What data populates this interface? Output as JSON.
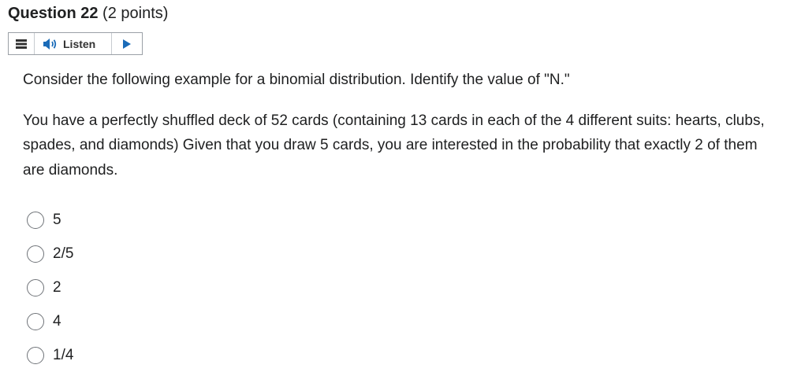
{
  "question": {
    "title": "Question 22",
    "points": "(2 points)"
  },
  "listen_toolbar": {
    "menu_icon": "hamburger-menu-icon",
    "speaker_icon": "speaker-icon",
    "listen_label": "Listen",
    "play_icon": "play-icon",
    "accent_color": "#1a6bb8"
  },
  "body": {
    "prompt": "Consider the following example for a binomial distribution.  Identify the value of \"N.\"",
    "scenario": "You have a perfectly shuffled deck of 52 cards (containing 13 cards in each of the 4 different suits: hearts, clubs, spades, and diamonds) Given that you draw 5 cards, you are interested in the probability that exactly 2 of them are diamonds."
  },
  "choices": [
    {
      "label": "5",
      "selected": false
    },
    {
      "label": "2/5",
      "selected": false
    },
    {
      "label": "2",
      "selected": false
    },
    {
      "label": "4",
      "selected": false
    },
    {
      "label": "1/4",
      "selected": false
    }
  ]
}
